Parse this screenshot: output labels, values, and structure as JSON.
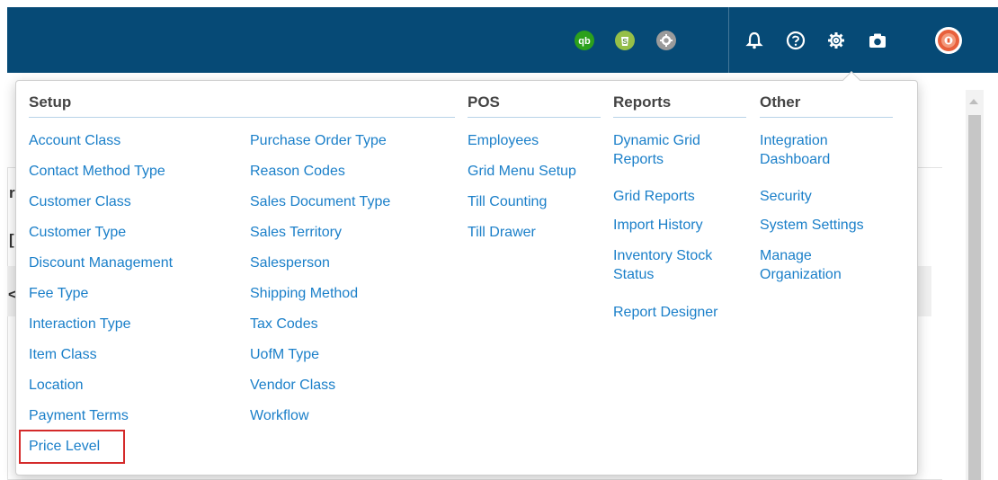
{
  "topbar": {
    "color": "#064a76",
    "icons": [
      {
        "name": "quickbooks-icon",
        "color": "#2ca01c"
      },
      {
        "name": "shopify-icon",
        "color": "#96bf48"
      },
      {
        "name": "settings-badge-icon",
        "color": "#9b9b9b"
      },
      {
        "name": "bell-icon"
      },
      {
        "name": "help-icon"
      },
      {
        "name": "gear-icon"
      },
      {
        "name": "camera-icon"
      },
      {
        "name": "avatar-icon",
        "color": "#e8603c"
      }
    ]
  },
  "menu": {
    "setup": {
      "heading": "Setup",
      "col1": [
        "Account Class",
        "Contact Method Type",
        "Customer Class",
        "Customer Type",
        "Discount Management",
        "Fee Type",
        "Interaction Type",
        "Item Class",
        "Location",
        "Payment Terms",
        "Price Level"
      ],
      "col2": [
        "Purchase Order Type",
        "Reason Codes",
        "Sales Document Type",
        "Sales Territory",
        "Salesperson",
        "Shipping Method",
        "Tax Codes",
        "UofM Type",
        "Vendor Class",
        "Workflow"
      ]
    },
    "pos": {
      "heading": "POS",
      "items": [
        "Employees",
        "Grid Menu Setup",
        "Till Counting",
        "Till Drawer"
      ]
    },
    "reports": {
      "heading": "Reports",
      "items": [
        "Dynamic Grid Reports",
        "Grid Reports",
        "Import History",
        "Inventory Stock Status",
        "Report Designer"
      ]
    },
    "other": {
      "heading": "Other",
      "items": [
        "Integration Dashboard",
        "Security",
        "System Settings",
        "Manage Organization"
      ]
    },
    "highlighted_item": "Price Level",
    "link_color": "#1a7fc9",
    "highlight_color": "#d42a2a"
  },
  "background": {
    "chars": [
      "r",
      "[",
      "<"
    ]
  }
}
